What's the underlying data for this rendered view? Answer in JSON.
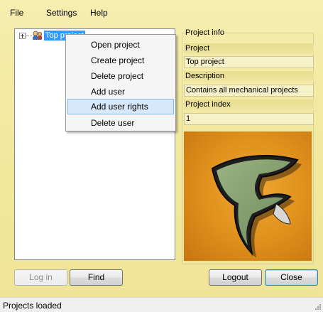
{
  "menubar": {
    "items": [
      "File",
      "Settings",
      "Help"
    ]
  },
  "tree": {
    "root_label": "Top project",
    "root_icon": "users-group-icon"
  },
  "context_menu": {
    "items": [
      "Open project",
      "Create project",
      "Delete project",
      "Add user",
      "Add user rights",
      "Delete user"
    ],
    "highlighted": "Add user rights"
  },
  "project_info": {
    "legend": "Project info",
    "project_label": "Project",
    "project_value": "Top project",
    "description_label": "Description",
    "description_value": "Contains all mechanical projects",
    "index_label": "Project index",
    "index_value": "1",
    "logo": "f-logo-image"
  },
  "buttons": {
    "login": "Log in",
    "find": "Find",
    "logout": "Logout",
    "close": "Close"
  },
  "status": {
    "text": "Projects loaded"
  },
  "colors": {
    "window_background": "#f3eca4",
    "selection": "#3399ff",
    "menu_highlight": "#d7e8fa",
    "logo_orange": "#de8e1b",
    "logo_green": "#7e9a6a"
  }
}
